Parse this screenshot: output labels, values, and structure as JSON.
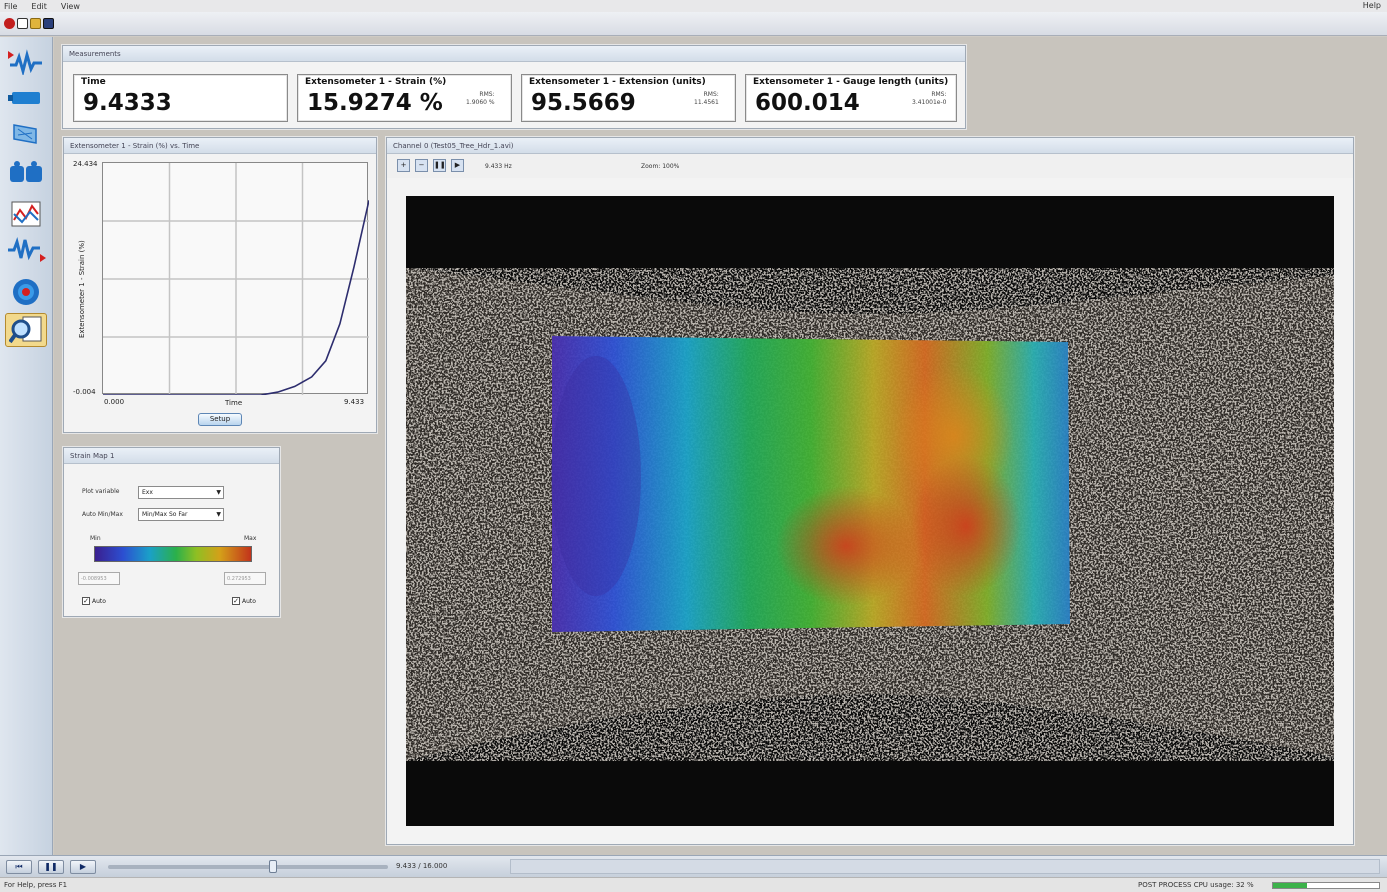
{
  "menu": {
    "items": [
      "File",
      "Edit",
      "View"
    ],
    "help": "Help"
  },
  "toolbar": {
    "icons": [
      "record-icon",
      "new-icon",
      "open-icon",
      "save-icon"
    ]
  },
  "sidebar": {
    "items": [
      "waveform-icon",
      "camera-icon",
      "calibration-icon",
      "correlation-icon",
      "graph-icon",
      "signal-icon",
      "target-icon",
      "analyze-icon"
    ],
    "active_index": 7
  },
  "measurements": {
    "title": "Measurements",
    "boxes": [
      {
        "label": "Time",
        "value": "9.4333"
      },
      {
        "label": "Extensometer 1 - Strain (%)",
        "value": "15.9274 %",
        "rms_label": "RMS:",
        "rms_value": "1.9060 %"
      },
      {
        "label": "Extensometer 1 - Extension (units)",
        "value": "95.5669",
        "rms_label": "RMS:",
        "rms_value": "11.4561"
      },
      {
        "label": "Extensometer 1 - Gauge length (units)",
        "value": "600.014",
        "rms_label": "RMS:",
        "rms_value": "3.41001e-0"
      }
    ]
  },
  "strain_chart": {
    "panel_title": "Extensometer 1 - Strain (%) vs. Time",
    "ylabel": "Extensometer 1 - Strain (%)",
    "xlabel": "Time",
    "y_max_label": "24.434",
    "y_min_label": "-0.004",
    "x_min_label": "0.000",
    "x_max_label": "9.433",
    "setup_label": "Setup"
  },
  "chart_data": {
    "type": "line",
    "xlabel": "Time",
    "ylabel": "Extensometer 1 - Strain (%)",
    "xlim": [
      0,
      9.433
    ],
    "ylim": [
      -0.004,
      24.434
    ],
    "grid": true,
    "series": [
      {
        "x": [
          0.0,
          1.5,
          3.0,
          4.5,
          5.6,
          6.2,
          6.8,
          7.4,
          7.9,
          8.4,
          8.9,
          9.433
        ],
        "y": [
          0.0,
          0.0,
          0.0,
          0.0,
          0.0,
          0.3,
          0.9,
          1.9,
          3.6,
          7.5,
          13.5,
          20.5
        ]
      }
    ]
  },
  "strain_map": {
    "title": "Strain Map 1",
    "plot_variable_label": "Plot variable",
    "plot_variable_value": "Exx",
    "auto_minmax_label": "Auto Min/Max",
    "auto_minmax_value": "Min/Max So Far",
    "min_label": "Min",
    "max_label": "Max",
    "min_value": "-0.008953",
    "max_value": "0.272953",
    "auto_min_label": "Auto",
    "auto_max_label": "Auto"
  },
  "image_view": {
    "title": "Channel 0 (Test05_Tree_Hdr_1.avi)",
    "frame_label": "9.433 Hz",
    "zoom_label": "Zoom: 100%"
  },
  "playback": {
    "time_label": "9.433 / 16.000",
    "position_fraction": 0.59
  },
  "status": {
    "left": "For Help, press F1",
    "right": "POST PROCESS  CPU usage: 32 %",
    "cpu_percent": 32
  }
}
